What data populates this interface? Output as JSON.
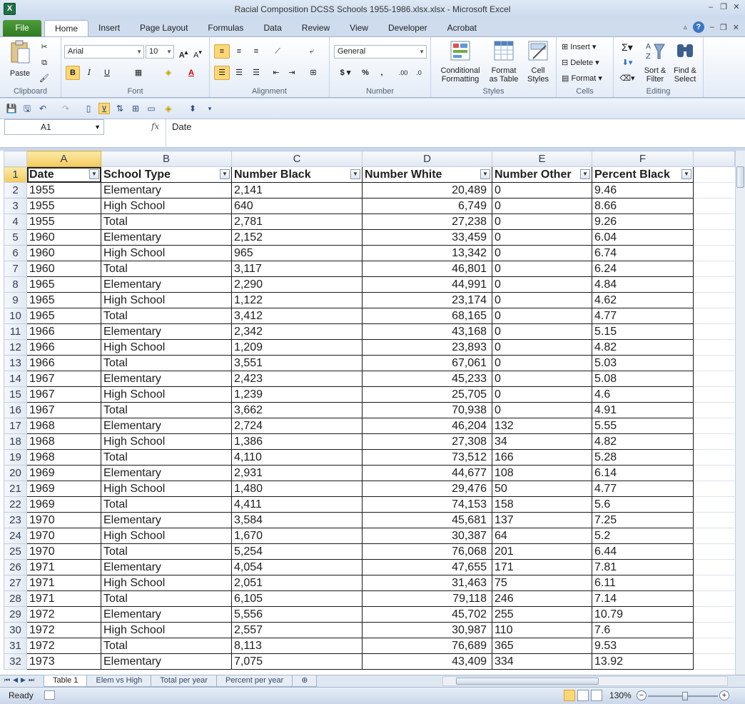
{
  "window": {
    "title": "Racial Composition DCSS Schools  1955-1986.xlsx.xlsx - Microsoft Excel",
    "app_icon": "X"
  },
  "ribbon": {
    "file_tab": "File",
    "tabs": [
      "Home",
      "Insert",
      "Page Layout",
      "Formulas",
      "Data",
      "Review",
      "View",
      "Developer",
      "Acrobat"
    ],
    "active_tab": "Home",
    "groups": {
      "clipboard": "Clipboard",
      "font": "Font",
      "alignment": "Alignment",
      "number": "Number",
      "styles": "Styles",
      "cells": "Cells",
      "editing": "Editing"
    },
    "paste_label": "Paste",
    "font_name": "Arial",
    "font_size": "10",
    "number_format": "General",
    "conditional_formatting": [
      "Conditional",
      "Formatting"
    ],
    "format_as_table": [
      "Format",
      "as Table"
    ],
    "cell_styles": [
      "Cell",
      "Styles"
    ],
    "insert": "Insert",
    "delete": "Delete",
    "format": "Format",
    "sort_filter": [
      "Sort &",
      "Filter"
    ],
    "find_select": [
      "Find &",
      "Select"
    ]
  },
  "formula_bar": {
    "name_box": "A1",
    "fx": "fx",
    "content": "Date"
  },
  "grid": {
    "columns": [
      "A",
      "B",
      "C",
      "D",
      "E",
      "F"
    ],
    "selected_column": "A",
    "headers": [
      "Date",
      "School Type",
      "Number Black",
      "Number White",
      "Number Other",
      "Percent Black"
    ],
    "rows": [
      [
        "1955",
        "Elementary",
        "2,141",
        "20,489",
        "0",
        "9.46"
      ],
      [
        "1955",
        "High School",
        "640",
        "6,749",
        "0",
        "8.66"
      ],
      [
        "1955",
        "Total",
        "2,781",
        "27,238",
        "0",
        "9.26"
      ],
      [
        "1960",
        "Elementary",
        "2,152",
        "33,459",
        "0",
        "6.04"
      ],
      [
        "1960",
        "High School",
        "965",
        "13,342",
        "0",
        "6.74"
      ],
      [
        "1960",
        "Total",
        "3,117",
        "46,801",
        "0",
        "6.24"
      ],
      [
        "1965",
        "Elementary",
        "2,290",
        "44,991",
        "0",
        "4.84"
      ],
      [
        "1965",
        "High School",
        "1,122",
        "23,174",
        "0",
        "4.62"
      ],
      [
        "1965",
        "Total",
        "3,412",
        "68,165",
        "0",
        "4.77"
      ],
      [
        "1966",
        "Elementary",
        "2,342",
        "43,168",
        "0",
        "5.15"
      ],
      [
        "1966",
        "High School",
        "1,209",
        "23,893",
        "0",
        "4.82"
      ],
      [
        "1966",
        "Total",
        "3,551",
        "67,061",
        "0",
        "5.03"
      ],
      [
        "1967",
        "Elementary",
        "2,423",
        "45,233",
        "0",
        "5.08"
      ],
      [
        "1967",
        "High School",
        "1,239",
        "25,705",
        "0",
        "4.6"
      ],
      [
        "1967",
        "Total",
        "3,662",
        "70,938",
        "0",
        "4.91"
      ],
      [
        "1968",
        "Elementary",
        "2,724",
        "46,204",
        "132",
        "5.55"
      ],
      [
        "1968",
        "High School",
        "1,386",
        "27,308",
        "34",
        "4.82"
      ],
      [
        "1968",
        "Total",
        "4,110",
        "73,512",
        "166",
        "5.28"
      ],
      [
        "1969",
        "Elementary",
        "2,931",
        "44,677",
        "108",
        "6.14"
      ],
      [
        "1969",
        "High School",
        "1,480",
        "29,476",
        "50",
        "4.77"
      ],
      [
        "1969",
        "Total",
        "4,411",
        "74,153",
        "158",
        "5.6"
      ],
      [
        "1970",
        "Elementary",
        "3,584",
        "45,681",
        "137",
        "7.25"
      ],
      [
        "1970",
        "High School",
        "1,670",
        "30,387",
        "64",
        "5.2"
      ],
      [
        "1970",
        "Total",
        "5,254",
        "76,068",
        "201",
        "6.44"
      ],
      [
        "1971",
        "Elementary",
        "4,054",
        "47,655",
        "171",
        "7.81"
      ],
      [
        "1971",
        "High School",
        "2,051",
        "31,463",
        "75",
        "6.11"
      ],
      [
        "1971",
        "Total",
        "6,105",
        "79,118",
        "246",
        "7.14"
      ],
      [
        "1972",
        "Elementary",
        "5,556",
        "45,702",
        "255",
        "10.79"
      ],
      [
        "1972",
        "High School",
        "2,557",
        "30,987",
        "110",
        "7.6"
      ],
      [
        "1972",
        "Total",
        "8,113",
        "76,689",
        "365",
        "9.53"
      ],
      [
        "1973",
        "Elementary",
        "7,075",
        "43,409",
        "334",
        "13.92"
      ]
    ]
  },
  "sheets": {
    "tabs": [
      "Table 1",
      "Elem vs High",
      "Total per year",
      "Percent per year"
    ],
    "active": "Table 1"
  },
  "status": {
    "ready": "Ready",
    "zoom": "130%"
  }
}
